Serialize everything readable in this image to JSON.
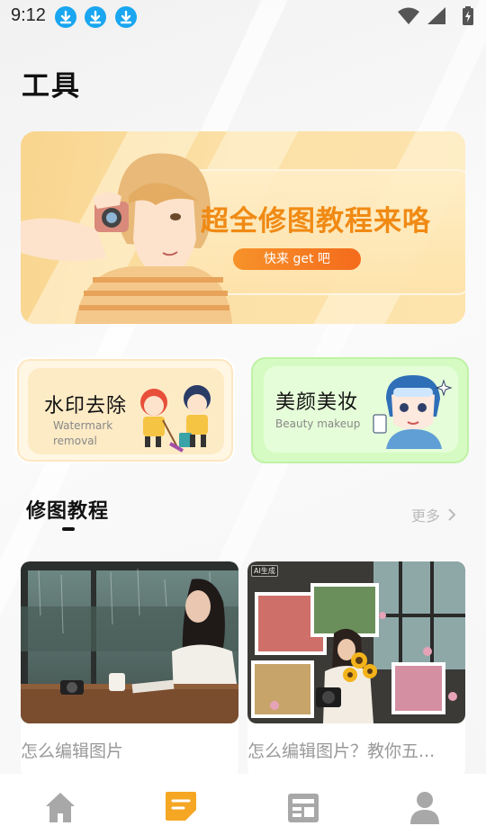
{
  "status_bar": {
    "time": "9:12",
    "notification_icons": [
      "download-icon",
      "download-icon",
      "download-icon"
    ],
    "system_icons": [
      "wifi-icon",
      "signal-icon",
      "battery-charging-icon"
    ]
  },
  "page": {
    "title": "工具"
  },
  "banner": {
    "title": "超全修图教程来咯",
    "button_label": "快来 get 吧",
    "colors": {
      "background": "#f9d58e",
      "title": "#f08a14",
      "button": "#f46b1c"
    }
  },
  "tools": [
    {
      "title": "水印去除",
      "subtitle": "Watermark removal",
      "color": "#fdebc6"
    },
    {
      "title": "美颜美妆",
      "subtitle": "Beauty makeup",
      "color": "#d5fbc2"
    }
  ],
  "tutorials": {
    "section_title": "修图教程",
    "more_label": "更多",
    "articles": [
      {
        "caption": "怎么编辑图片",
        "ai_tag": ""
      },
      {
        "caption": "怎么编辑图片？教你五...",
        "ai_tag": "AI生成"
      }
    ]
  },
  "bottom_nav": {
    "items": [
      {
        "icon": "home-icon",
        "active": false
      },
      {
        "icon": "notes-icon",
        "active": true
      },
      {
        "icon": "news-icon",
        "active": false
      },
      {
        "icon": "profile-icon",
        "active": false
      }
    ],
    "active_color": "#f5a623",
    "inactive_color": "#a8a8a8"
  }
}
